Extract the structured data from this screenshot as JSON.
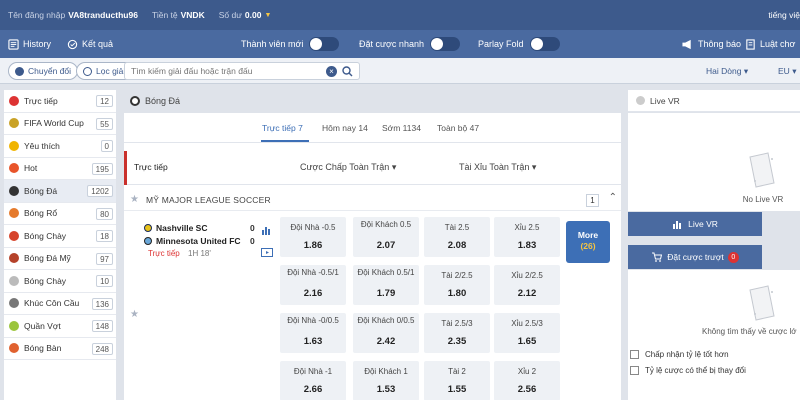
{
  "topbar": {
    "login_label": "Tên đăng nhập",
    "username": "VA8tranducthu96",
    "currency_label": "Tiền tệ",
    "currency": "VNDK",
    "balance_label": "Số dư",
    "balance": "0.00",
    "language": "tiếng việ"
  },
  "nav": {
    "history": "History",
    "results": "Kết quả",
    "new_member": "Thành viên mới",
    "quick_bet": "Đặt cược nhanh",
    "parlay_fold": "Parlay Fold",
    "notice": "Thông báo",
    "rules": "Luật chơ"
  },
  "filter": {
    "switch": "Chuyển đổi",
    "league_filter": "Lọc giải đấu",
    "search_placeholder": "Tìm kiếm giải đấu hoặc trận đấu",
    "odds_type": "Hai Dòng",
    "odds_format": "EU"
  },
  "sidebar": {
    "items": [
      {
        "label": "Trực tiếp",
        "count": "12",
        "icon": "live-icon",
        "color": "#d33"
      },
      {
        "label": "FIFA World Cup",
        "count": "55",
        "icon": "trophy-icon",
        "color": "#c9a227"
      },
      {
        "label": "Yêu thích",
        "count": "0",
        "icon": "star-icon",
        "color": "#f0b400"
      },
      {
        "label": "Hot",
        "count": "195",
        "icon": "fire-icon",
        "color": "#e8542a"
      },
      {
        "label": "Bóng Đá",
        "count": "1202",
        "icon": "soccer-ball-icon",
        "color": "#333"
      },
      {
        "label": "Bóng Rổ",
        "count": "80",
        "icon": "basketball-icon",
        "color": "#e57a2c"
      },
      {
        "label": "Bóng Chày",
        "count": "18",
        "icon": "baseball-icon",
        "color": "#d6432b"
      },
      {
        "label": "Bóng Đá Mỹ",
        "count": "97",
        "icon": "american-football-icon",
        "color": "#b5422a"
      },
      {
        "label": "Bóng Chày",
        "count": "10",
        "icon": "softball-icon",
        "color": "#bbb"
      },
      {
        "label": "Khúc Côn Cầu",
        "count": "136",
        "icon": "hockey-stick-icon",
        "color": "#777"
      },
      {
        "label": "Quần Vợt",
        "count": "148",
        "icon": "tennis-ball-icon",
        "color": "#9bc53d"
      },
      {
        "label": "Bóng Bàn",
        "count": "248",
        "icon": "ping-pong-icon",
        "color": "#e0612f"
      }
    ]
  },
  "main": {
    "title": "Bóng Đá",
    "tabs": [
      "Trực tiếp 7",
      "Hôm nay 14",
      "Sớm 1134",
      "Toàn bộ 47"
    ],
    "live_label": "Trực tiếp",
    "col_handicap": "Cược Chấp Toàn Trận",
    "col_overunder": "Tài Xỉu Toàn Trận",
    "league": "MỸ MAJOR LEAGUE SOCCER",
    "league_count": "1",
    "match": {
      "home": "Nashville SC",
      "away": "Minnesota United FC",
      "home_score": "0",
      "away_score": "0",
      "status": "Trực tiếp",
      "time": "1H 18'"
    },
    "odds": [
      [
        {
          "label": "Đội Nhà -0.5",
          "value": "1.86"
        },
        {
          "label": "Đội Khách 0.5",
          "value": "2.07"
        },
        {
          "label": "Tài 2.5",
          "value": "2.08"
        },
        {
          "label": "Xỉu 2.5",
          "value": "1.83"
        }
      ],
      [
        {
          "label": "Đội Nhà -0.5/1",
          "value": "2.16"
        },
        {
          "label": "Đội Khách 0.5/1",
          "value": "1.79"
        },
        {
          "label": "Tài 2/2.5",
          "value": "1.80"
        },
        {
          "label": "Xỉu 2/2.5",
          "value": "2.12"
        }
      ],
      [
        {
          "label": "Đội Nhà -0/0.5",
          "value": "1.63"
        },
        {
          "label": "Đội Khách 0/0.5",
          "value": "2.42"
        },
        {
          "label": "Tài 2.5/3",
          "value": "2.35"
        },
        {
          "label": "Xỉu 2.5/3",
          "value": "1.65"
        }
      ],
      [
        {
          "label": "Đội Nhà -1",
          "value": "2.66"
        },
        {
          "label": "Đội Khách 1",
          "value": "1.53"
        },
        {
          "label": "Tài 2",
          "value": "1.55"
        },
        {
          "label": "Xỉu 2",
          "value": "2.56"
        }
      ]
    ],
    "more_label": "More",
    "more_count": "(26)"
  },
  "right": {
    "live_vr_title": "Live VR",
    "no_live_vr": "No Live VR",
    "live_vr_tab": "Live VR",
    "bet_slip_tab": "Đặt cược trượt",
    "bet_slip_count": "0",
    "no_odds": "Không tìm thấy về cược lớ",
    "accept_better": "Chấp nhận tỷ lệ tốt hơn",
    "odds_may_change": "Tỷ lệ cược có thể bị thay đổi"
  },
  "colors": {
    "topbar": "#3d5a8c",
    "navbar": "#4a6aa0",
    "accent": "#3d6fb6",
    "live_red": "#d33"
  }
}
